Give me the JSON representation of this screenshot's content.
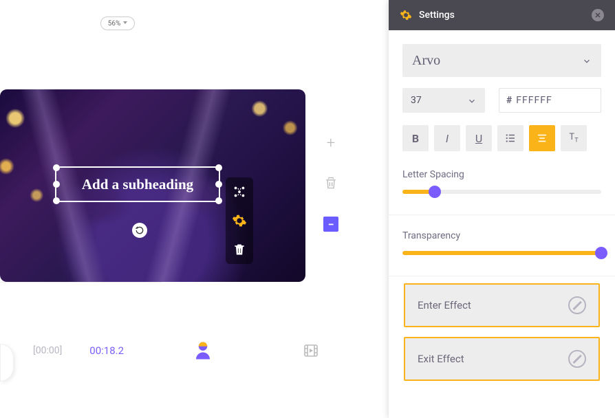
{
  "zoom": "56%",
  "canvas": {
    "subheading_text": "Add a subheading"
  },
  "timeline": {
    "start": "[00:00]",
    "current": "00:18.2"
  },
  "settings": {
    "title": "Settings",
    "font": "Arvo",
    "font_size": "37",
    "color_hex": "FFFFFF",
    "letter_spacing_label": "Letter Spacing",
    "letter_spacing_pct": 15,
    "transparency_label": "Transparency",
    "transparency_pct": 100,
    "enter_effect_label": "Enter Effect",
    "exit_effect_label": "Exit Effect"
  }
}
